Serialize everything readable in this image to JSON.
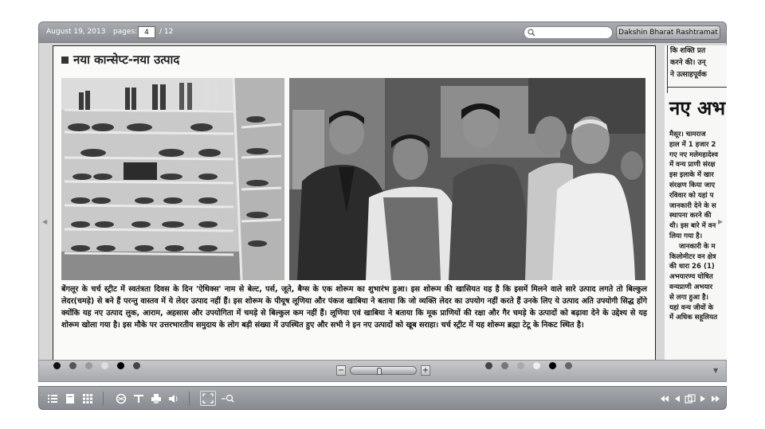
{
  "toolbar": {
    "date": "August 19, 2013",
    "pages_label": "pages:",
    "current_page": "4",
    "total_pages": "/ 12",
    "search_placeholder": "",
    "publication_button": "Dakshin Bharat Rashtramat"
  },
  "clipping": {
    "title": "नया कान्सेप्ट-नया उत्पाद",
    "article": "बेंगलूर के चर्च स्ट्रीट में स्वतंत्रता दिवस के दिन 'ऐथिक्स' नाम से बेल्ट, पर्स, जूते, बैग्स के एक शोरूम का शुभारंभ हुआ। इस शोरूम की खासियत यह है कि इसमें मिलने वाले सारे उत्पाद लगते तो बिल्कुल लेदर(चमड़े) से बने हैं परन्तु वास्तव में ये लेदर उत्पाद नहीं हैं। इस शोरूम के पीयूष लूणिया और पंकज खाबिया ने बताया कि जो व्यक्ति लेदर का उपयोग नहीं करते हैं उनके लिए ये उत्पाद अति उपयोगी सिद्ध होंगे क्योंकि यह नए उत्पाद लुक, आराम, अहसास और उपयोगिता में चमड़े से बिल्कुल कम नहीं हैं। लूणिया एवं खाबिया ने बताया कि मूक प्राणियों की रक्षा और गैर चमड़े के उत्पादों को बढ़ावा देने के उद्देश्य से यह शोरूम खोला गया है। इस मौके पर उत्तरभारतीय समुदाय के लोग बड़ी संख्या में उपस्थित हुए और सभी ने इन नए उत्पादों को खूब सराहा। चर्च स्ट्रीट में यह शोरूम ब्रह्मा टेटू के निकट स्थित है।"
  },
  "adjacent_column": {
    "top_lines": [
      "कि शक्ति प्रत",
      "करने की। उन्",
      "ने उत्साहपूर्वक"
    ],
    "headline": "नए अभ",
    "body_lines": [
      "मैसूर। चामराज",
      "हाल में 1 हजार 2",
      "गए नए मलेमहादेश्व",
      "में वन्य प्राणी संरक्ष",
      "इस इलाके में खार",
      "संरक्षण किया जाए",
      "रविवार को यहां प",
      "जानकारी देने के स",
      "स्थापना करने की",
      "थी। इस बारे में वन",
      "लिया गया है।",
      "जानकारी के म",
      "किलोमीटर वन क्षेत्र",
      "की धारा 26 (1)",
      "अभयारण्य घोषित",
      "वन्यप्राणी अभयार",
      "से लगा हुआ है।",
      "यहां वन्य जीवों के",
      "में अधिक सहूलियत"
    ]
  },
  "icons": {
    "search": "search-icon",
    "list": "list-view-icon",
    "page": "single-page-icon",
    "grid": "thumbnails-grid-icon",
    "share": "share-globe-icon",
    "text": "text-view-icon",
    "print": "print-icon",
    "audio": "speaker-icon",
    "fullscreen": "fullscreen-icon",
    "zoom": "zoom-out-icon",
    "first": "first-page-icon",
    "prev": "previous-page-icon",
    "spread": "two-page-spread-icon",
    "next": "next-page-icon",
    "last": "last-page-icon"
  },
  "zoom": {
    "minus": "−",
    "plus": "+",
    "level": 0.45
  },
  "colors": {
    "toolbar": "#8a8e93",
    "stage": "#d7d7d8",
    "print_dots": [
      "#111111",
      "#555555",
      "#999999",
      "#dddddd",
      "#ffffff",
      "#000000",
      "#444444"
    ]
  }
}
